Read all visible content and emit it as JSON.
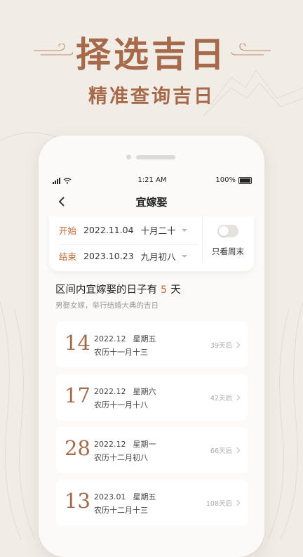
{
  "promo": {
    "headline": "择选吉日",
    "subline": "精准查询吉日"
  },
  "status_bar": {
    "time": "1:21 AM",
    "battery": "100%"
  },
  "nav": {
    "title": "宜嫁娶"
  },
  "range": {
    "start": {
      "label": "开始",
      "date": "2022.11.04",
      "lunar": "十月二十"
    },
    "end": {
      "label": "结束",
      "date": "2023.10.23",
      "lunar": "九月初八"
    },
    "toggle_label": "只看周末",
    "toggle_on": false
  },
  "summary": {
    "prefix": "区间内宜嫁娶的日子有",
    "count": "5",
    "suffix": "天",
    "subtitle": "男娶女嫁，举行结婚大典的吉日"
  },
  "days": [
    {
      "day": "14",
      "month": "2022.12",
      "weekday": "星期五",
      "lunar": "农历十一月十三",
      "after": "39天后"
    },
    {
      "day": "17",
      "month": "2022.12",
      "weekday": "星期六",
      "lunar": "农历十一月十八",
      "after": "42天后"
    },
    {
      "day": "28",
      "month": "2022.12",
      "weekday": "星期一",
      "lunar": "农历十二月初八",
      "after": "66天后"
    },
    {
      "day": "13",
      "month": "2023.01",
      "weekday": "星期五",
      "lunar": "农历十二月十三",
      "after": "108天后"
    }
  ],
  "colors": {
    "accent": "#c46a3a",
    "brand": "#a6694a",
    "background": "#f1ede6"
  }
}
